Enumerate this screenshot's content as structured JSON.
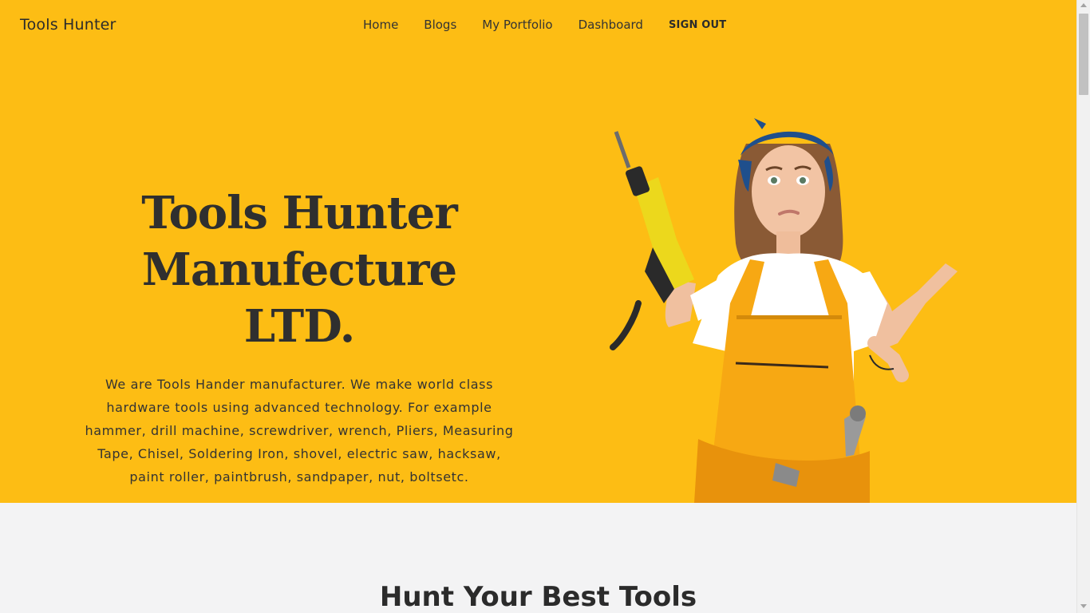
{
  "navbar": {
    "brand": "Tools Hunter",
    "links": [
      "Home",
      "Blogs",
      "My Portfolio",
      "Dashboard"
    ],
    "signout_label": "SIGN OUT"
  },
  "hero": {
    "title_line1": "Tools Hunter",
    "title_line2": "Manufecture LTD.",
    "description": "We are Tools Hander manufacturer. We make world class hardware tools using advanced technology. For example hammer, drill machine, screwdriver, wrench, Pliers, Measuring Tape, Chisel, Soldering Iron, shovel, electric saw, hacksaw, paint roller, paintbrush, sandpaper, nut, boltsetc.",
    "image_icon": "woman-with-drill-illustration"
  },
  "section": {
    "title": "Hunt Your Best Tools"
  },
  "colors": {
    "hero_bg": "#fdbd14",
    "page_bg": "#f3f3f4",
    "text_dark": "#2f2f2f"
  }
}
